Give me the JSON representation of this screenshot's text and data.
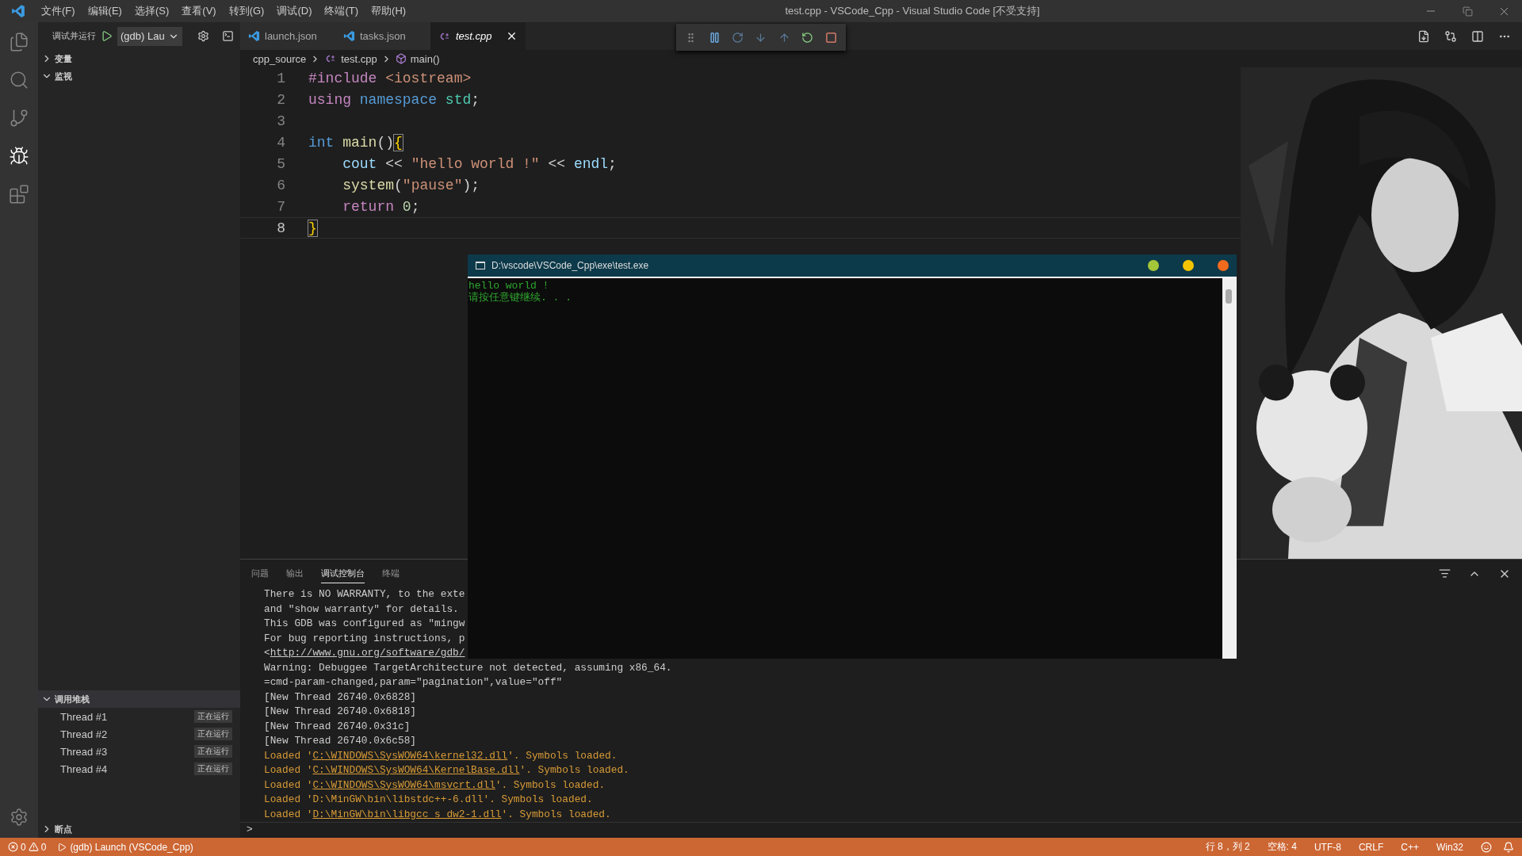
{
  "title_bar": {
    "menus": [
      "文件(F)",
      "编辑(E)",
      "选择(S)",
      "查看(V)",
      "转到(G)",
      "调试(D)",
      "终端(T)",
      "帮助(H)"
    ],
    "title": "test.cpp - VSCode_Cpp - Visual Studio Code [不受支持]"
  },
  "activity_bar": [
    {
      "kind": "files",
      "selected": false
    },
    {
      "kind": "search",
      "selected": false
    },
    {
      "kind": "scm",
      "selected": false
    },
    {
      "kind": "debug",
      "selected": true
    },
    {
      "kind": "extensions",
      "selected": false
    }
  ],
  "debug_sidebar": {
    "title": "调试并运行",
    "configuration": "(gdb) Lau",
    "sections": [
      {
        "kind": "variables",
        "title": "变量",
        "expanded": false
      },
      {
        "kind": "watch",
        "title": "监视",
        "expanded": true
      },
      {
        "kind": "callstack",
        "title": "调用堆栈",
        "expanded": true,
        "threads": [
          {
            "name": "Thread #1",
            "status": "正在运行"
          },
          {
            "name": "Thread #2",
            "status": "正在运行"
          },
          {
            "name": "Thread #3",
            "status": "正在运行"
          },
          {
            "name": "Thread #4",
            "status": "正在运行"
          }
        ]
      },
      {
        "kind": "breakpoints",
        "title": "断点",
        "expanded": false
      }
    ]
  },
  "tabs": [
    {
      "label": "launch.json",
      "kind": "json",
      "selected": false,
      "preview": false
    },
    {
      "label": "tasks.json",
      "kind": "json",
      "selected": false,
      "preview": false
    },
    {
      "label": "test.cpp",
      "kind": "cpp",
      "selected": true,
      "preview": true
    }
  ],
  "breadcrumb": [
    {
      "label": "cpp_source",
      "kind": "folder"
    },
    {
      "label": "test.cpp",
      "kind": "cpp"
    },
    {
      "label": "main()",
      "kind": "symbol"
    }
  ],
  "code": [
    {
      "number": "1",
      "current": false,
      "tokens": [
        {
          "text": "#include ",
          "kind": "directive"
        },
        {
          "text": "<iostream>",
          "kind": "string"
        }
      ]
    },
    {
      "number": "2",
      "current": false,
      "tokens": [
        {
          "text": "using ",
          "kind": "directive"
        },
        {
          "text": "namespace ",
          "kind": "keyword"
        },
        {
          "text": "std",
          "kind": "type"
        },
        {
          "text": ";",
          "kind": "plain"
        }
      ]
    },
    {
      "number": "3",
      "current": false
    },
    {
      "number": "4",
      "current": false,
      "tokens": [
        {
          "text": "int ",
          "kind": "keyword"
        },
        {
          "text": "main",
          "kind": "func"
        },
        {
          "text": "()",
          "kind": "plain"
        },
        {
          "text": "{",
          "kind": "brace",
          "match": true
        }
      ]
    },
    {
      "number": "5",
      "current": false,
      "tokens": [
        {
          "text": "    cout",
          "kind": "var"
        },
        {
          "text": " << ",
          "kind": "plain"
        },
        {
          "text": "\"hello world !\"",
          "kind": "string"
        },
        {
          "text": " << ",
          "kind": "plain"
        },
        {
          "text": "endl",
          "kind": "var"
        },
        {
          "text": ";",
          "kind": "plain"
        }
      ]
    },
    {
      "number": "6",
      "current": false,
      "tokens": [
        {
          "text": "    system",
          "kind": "func"
        },
        {
          "text": "(",
          "kind": "plain"
        },
        {
          "text": "\"pause\"",
          "kind": "string"
        },
        {
          "text": ");",
          "kind": "plain"
        }
      ]
    },
    {
      "number": "7",
      "current": false,
      "tokens": [
        {
          "text": "    return ",
          "kind": "directive"
        },
        {
          "text": "0",
          "kind": "number"
        },
        {
          "text": ";",
          "kind": "plain"
        }
      ]
    },
    {
      "number": "8",
      "current": true,
      "tokens": [
        {
          "text": "}",
          "kind": "brace",
          "match": true
        }
      ]
    }
  ],
  "console_window": {
    "title": "D:\\vscode\\VSCode_Cpp\\exe\\test.exe",
    "lines": [
      "hello world !",
      "请按任意键继续. . ."
    ]
  },
  "panel": {
    "tabs": [
      {
        "label": "问题",
        "selected": false
      },
      {
        "label": "输出",
        "selected": false
      },
      {
        "label": "调试控制台",
        "selected": true
      },
      {
        "label": "终端",
        "selected": false
      }
    ],
    "lines": [
      {
        "kind": "plain",
        "text": "There is NO WARRANTY, to the exte"
      },
      {
        "kind": "plain",
        "text": "and \"show warranty\" for details."
      },
      {
        "kind": "plain",
        "text": "This GDB was configured as \"mingw"
      },
      {
        "kind": "plain",
        "text": "For bug reporting instructions, p"
      },
      {
        "kind": "plain",
        "text": "<",
        "link": "http://www.gnu.org/software/gdb/"
      },
      {
        "kind": "plain",
        "text": "Warning: Debuggee TargetArchitecture not detected, assuming x86_64."
      },
      {
        "kind": "plain",
        "text": "=cmd-param-changed,param=\"pagination\",value=\"off\""
      },
      {
        "kind": "plain",
        "text": "[New Thread 26740.0x6828]"
      },
      {
        "kind": "plain",
        "text": "[New Thread 26740.0x6818]"
      },
      {
        "kind": "plain",
        "text": "[New Thread 26740.0x31c]"
      },
      {
        "kind": "plain",
        "text": "[New Thread 26740.0x6c58]"
      },
      {
        "kind": "log",
        "text": "Loaded '",
        "link": "C:\\WINDOWS\\SysWOW64\\kernel32.dll",
        "suffix": "'. Symbols loaded."
      },
      {
        "kind": "log",
        "text": "Loaded '",
        "link": "C:\\WINDOWS\\SysWOW64\\KernelBase.dll",
        "suffix": "'. Symbols loaded."
      },
      {
        "kind": "log",
        "text": "Loaded '",
        "link": "C:\\WINDOWS\\SysWOW64\\msvcrt.dll",
        "suffix": "'. Symbols loaded."
      },
      {
        "kind": "log",
        "text": "Loaded 'D:\\MinGW\\bin\\libstdc++-6.dll'. Symbols loaded."
      },
      {
        "kind": "log",
        "text": "Loaded '",
        "link": "D:\\MinGW\\bin\\libgcc_s_dw2-1.dll",
        "suffix": "'. Symbols loaded."
      }
    ],
    "prompt": ">"
  },
  "status_bar": {
    "errors": "0",
    "warnings": "0",
    "launch": "(gdb) Launch (VSCode_Cpp)",
    "items": [
      "行 8，列 2",
      "空格: 4",
      "UTF-8",
      "CRLF",
      "C++",
      "Win32"
    ]
  }
}
